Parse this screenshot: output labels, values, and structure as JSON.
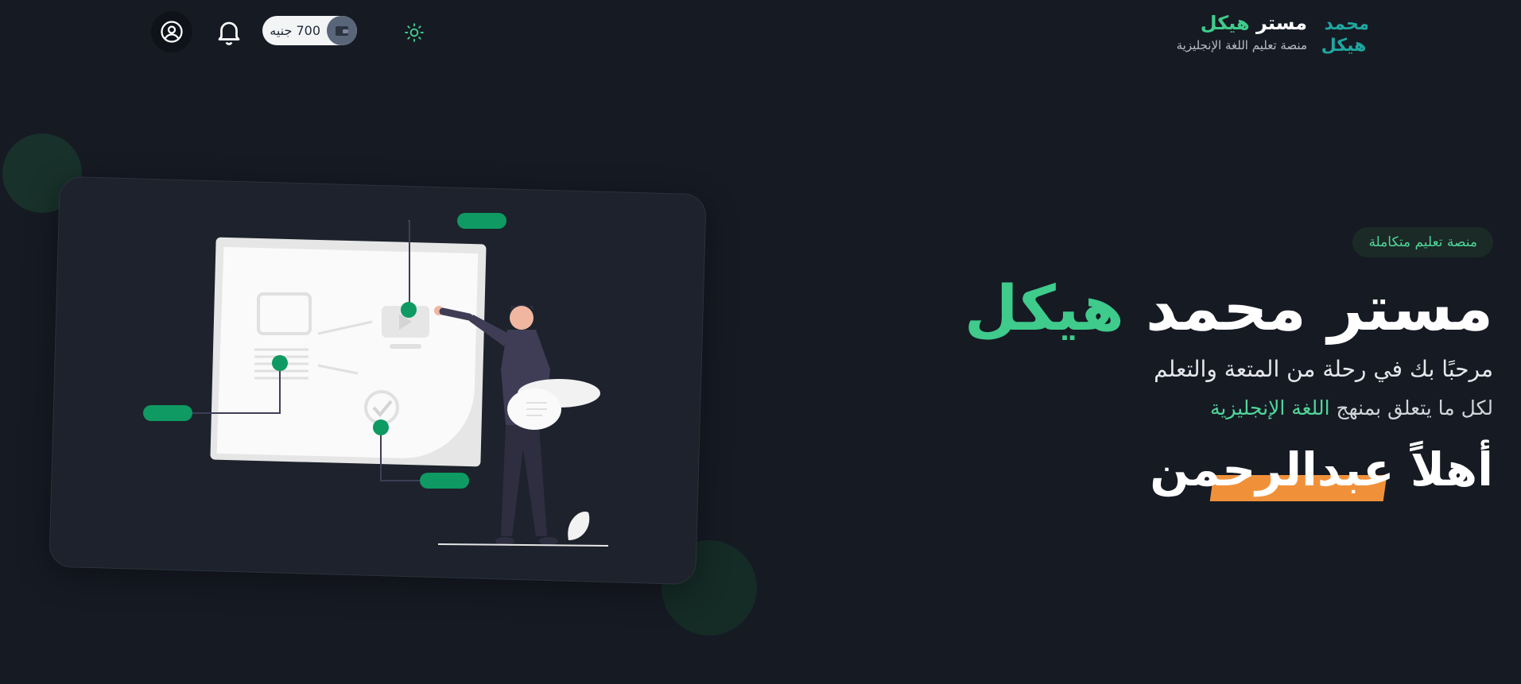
{
  "header": {
    "wallet": {
      "amount": "700 جنيه"
    },
    "brand": {
      "logo_text_top": "محمد",
      "logo_text_bottom": "هيكل",
      "name_prefix": "مستر",
      "name_accent": "هيكل",
      "subtitle": "منصة تعليم اللغة الإنجليزية"
    }
  },
  "hero": {
    "badge": "منصة تعليم متكاملة",
    "title_main": "مستر محمد",
    "title_accent": "هيكل",
    "subtitle1": "مرحبًا بك في رحلة من المتعة والتعلم",
    "subtitle2_prefix": "لكل ما يتعلق بمنهج",
    "subtitle2_accent": "اللغة الإنجليزية",
    "greeting": "أهلاً عبدالرحمن"
  },
  "colors": {
    "background": "#161a23",
    "accent_green": "#3fcb8b",
    "accent_orange": "#f0913a",
    "card": "#1d222c"
  },
  "icons": [
    "user-circle-icon",
    "bell-icon",
    "wallet-icon",
    "sun-icon"
  ]
}
